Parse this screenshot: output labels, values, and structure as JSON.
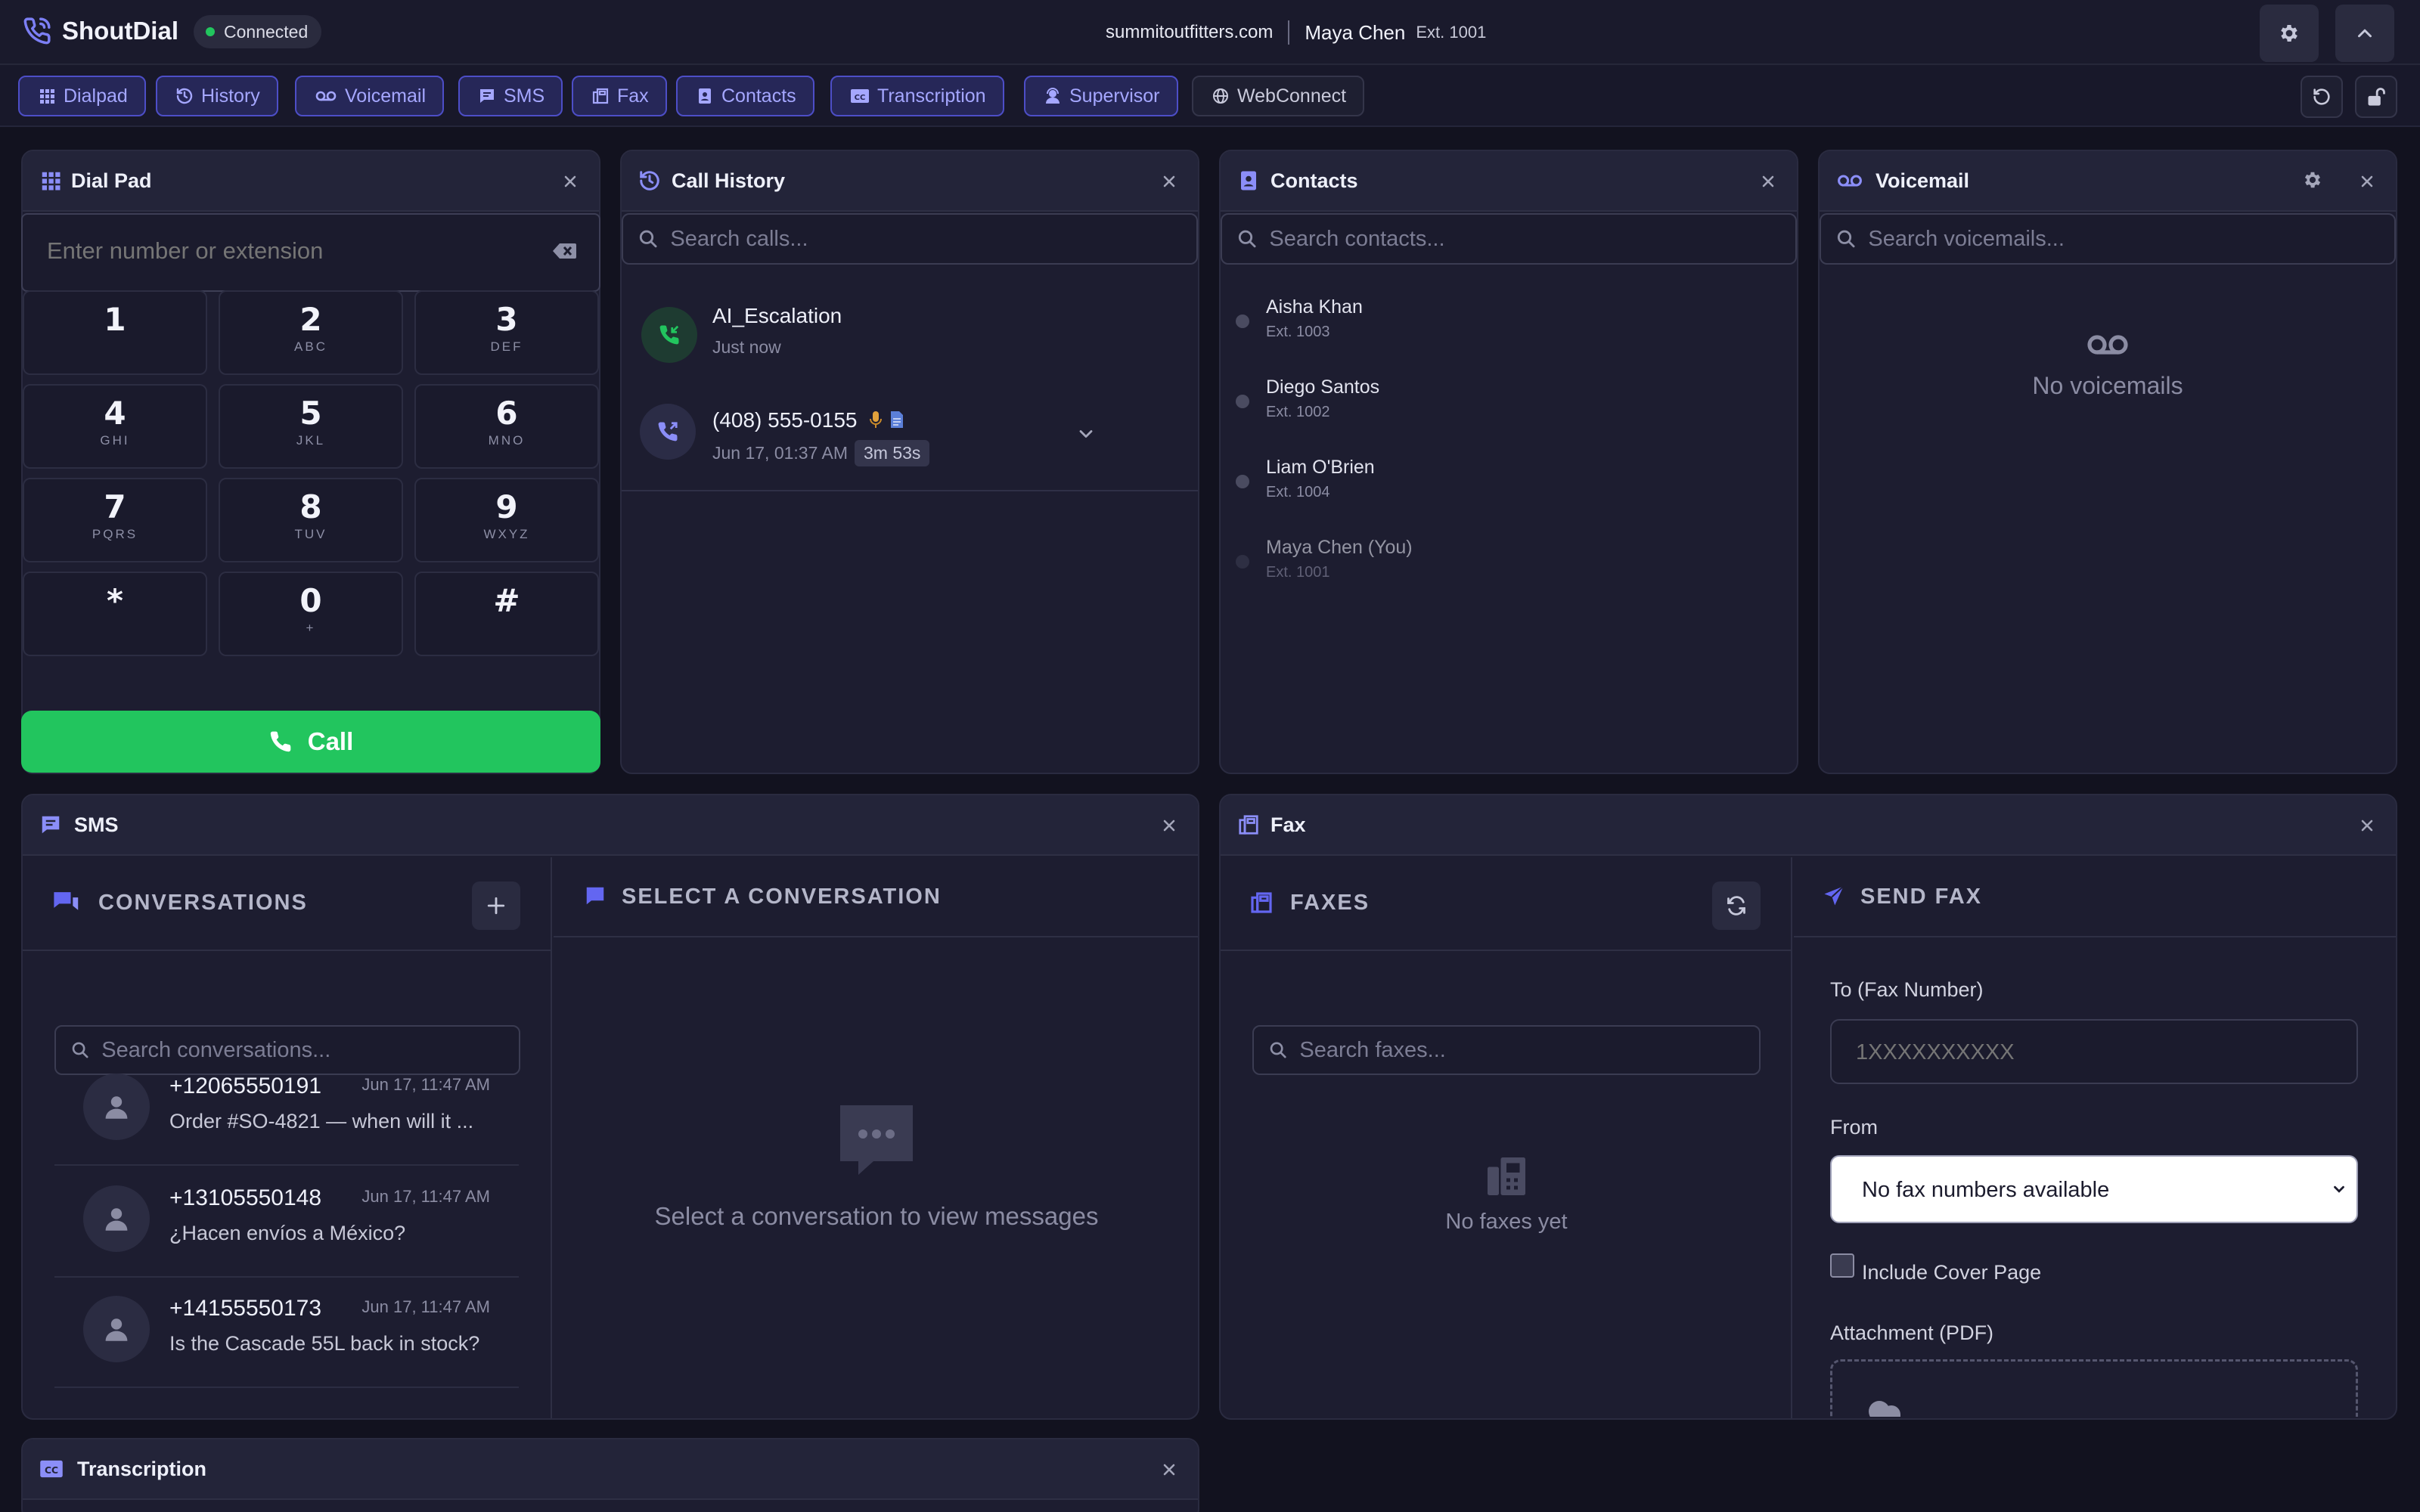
{
  "header": {
    "app_name": "ShoutDial",
    "status": "Connected",
    "domain": "summitoutfitters.com",
    "user_name": "Maya Chen",
    "user_ext": "Ext. 1001"
  },
  "nav": {
    "tabs": [
      "Dialpad",
      "History",
      "Voicemail",
      "SMS",
      "Fax",
      "Contacts",
      "Transcription",
      "Supervisor",
      "WebConnect"
    ]
  },
  "dialpad": {
    "title": "Dial Pad",
    "placeholder": "Enter number or extension",
    "keys": [
      {
        "digit": "1",
        "letters": ""
      },
      {
        "digit": "2",
        "letters": "ABC"
      },
      {
        "digit": "3",
        "letters": "DEF"
      },
      {
        "digit": "4",
        "letters": "GHI"
      },
      {
        "digit": "5",
        "letters": "JKL"
      },
      {
        "digit": "6",
        "letters": "MNO"
      },
      {
        "digit": "7",
        "letters": "PQRS"
      },
      {
        "digit": "8",
        "letters": "TUV"
      },
      {
        "digit": "9",
        "letters": "WXYZ"
      },
      {
        "digit": "*",
        "letters": ""
      },
      {
        "digit": "0",
        "letters": "+"
      },
      {
        "digit": "#",
        "letters": ""
      }
    ],
    "call_label": "Call"
  },
  "history": {
    "title": "Call History",
    "placeholder": "Search calls...",
    "calls": [
      {
        "name": "AI_Escalation",
        "time": "Just now"
      },
      {
        "name": "(408) 555-0155",
        "time": "Jun 17, 01:37 AM",
        "duration": "3m 53s"
      }
    ]
  },
  "contacts": {
    "title": "Contacts",
    "placeholder": "Search contacts...",
    "items": [
      {
        "name": "Aisha Khan",
        "ext": "Ext. 1003"
      },
      {
        "name": "Diego Santos",
        "ext": "Ext. 1002"
      },
      {
        "name": "Liam O'Brien",
        "ext": "Ext. 1004"
      },
      {
        "name": "Maya Chen (You)",
        "ext": "Ext. 1001"
      }
    ]
  },
  "voicemail": {
    "title": "Voicemail",
    "placeholder": "Search voicemails...",
    "empty": "No voicemails"
  },
  "sms": {
    "title": "SMS",
    "conversations_label": "CONVERSATIONS",
    "select_label": "SELECT A CONVERSATION",
    "placeholder": "Search conversations...",
    "empty": "Select a conversation to view messages",
    "conversations": [
      {
        "number": "+12065550191",
        "time": "Jun 17, 11:47 AM",
        "preview": "Order #SO-4821 — when will it ..."
      },
      {
        "number": "+13105550148",
        "time": "Jun 17, 11:47 AM",
        "preview": "¿Hacen envíos a México?"
      },
      {
        "number": "+14155550173",
        "time": "Jun 17, 11:47 AM",
        "preview": "Is the Cascade 55L back in stock?"
      }
    ]
  },
  "fax": {
    "title": "Fax",
    "faxes_label": "FAXES",
    "send_label": "SEND FAX",
    "placeholder": "Search faxes...",
    "empty": "No faxes yet",
    "to_label": "To (Fax Number)",
    "to_placeholder": "1XXXXXXXXXX",
    "from_label": "From",
    "from_value": "No fax numbers available",
    "cover_label": "Include Cover Page",
    "attachment_label": "Attachment (PDF)"
  },
  "transcription": {
    "title": "Transcription"
  },
  "colors": {
    "accent": "#6366f1",
    "success": "#22c55e",
    "background": "#12121f"
  }
}
